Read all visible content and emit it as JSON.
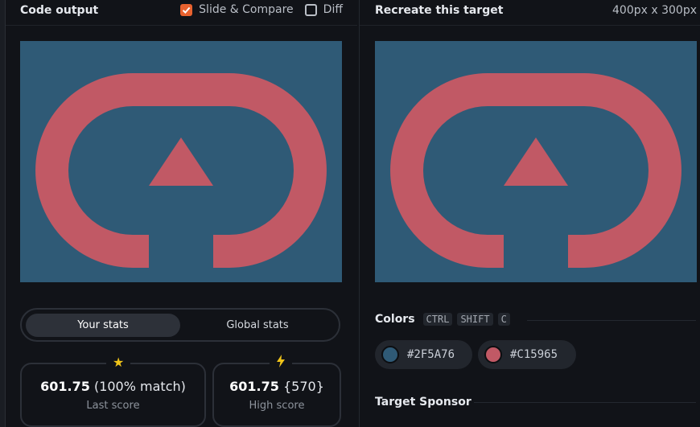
{
  "left_panel": {
    "title": "Code output",
    "slide_compare": {
      "label": "Slide & Compare",
      "checked": true
    },
    "diff": {
      "label": "Diff",
      "checked": false
    },
    "stats_tabs": {
      "your_stats": "Your stats",
      "global_stats": "Global stats",
      "active": "your_stats"
    },
    "last_score": {
      "icon": "star-icon",
      "value": "601.75",
      "detail": "(100% match)",
      "label": "Last score"
    },
    "high_score": {
      "icon": "bolt-icon",
      "value": "601.75",
      "detail": "{570}",
      "label": "High score"
    }
  },
  "right_panel": {
    "title": "Recreate this target",
    "size": "400px x 300px",
    "colors": {
      "label": "Colors",
      "shortcut": [
        "CTRL",
        "SHIFT",
        "C"
      ],
      "swatches": [
        {
          "hex": "#2F5A76",
          "color": "#2F5A76"
        },
        {
          "hex": "#C15965",
          "color": "#C15965"
        }
      ]
    },
    "sponsor_label": "Target Sponsor"
  },
  "canvas": {
    "background": "#2F5A76",
    "shape_color": "#C15965"
  }
}
